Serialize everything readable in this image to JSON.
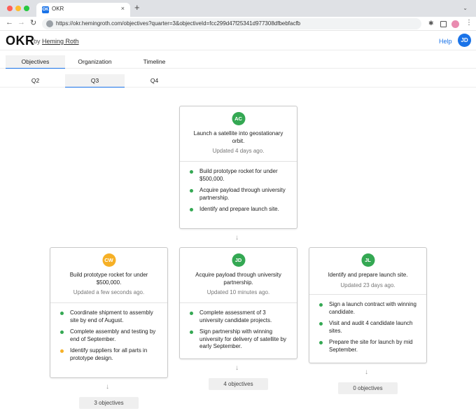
{
  "browser": {
    "tab_icon": "OK",
    "tab_title": "OKR",
    "tab_close": "×",
    "new_tab": "+",
    "url": "https://okr.hemingroth.com/objectives?quarter=3&objectiveId=fcc299d47f25341d977308dfbebfacfb"
  },
  "header": {
    "brand": "OKR",
    "by": "by",
    "author": "Heming Roth",
    "help": "Help",
    "user_initials": "JD"
  },
  "main_tabs": [
    {
      "label": "Objectives",
      "active": true
    },
    {
      "label": "Organization",
      "active": false
    },
    {
      "label": "Timeline",
      "active": false
    }
  ],
  "quarter_tabs": [
    {
      "label": "Q2",
      "active": false
    },
    {
      "label": "Q3",
      "active": true
    },
    {
      "label": "Q4",
      "active": false
    }
  ],
  "colors": {
    "green": "#34a853",
    "orange": "#f6b026",
    "blue": "#1a73e8"
  },
  "root": {
    "initials": "AC",
    "title": "Launch a satellite into geostationary orbit.",
    "updated": "Updated 4 days ago.",
    "key_results": [
      {
        "text": "Build prototype rocket for under $500,000.",
        "status": "green"
      },
      {
        "text": "Acquire payload through university partnership.",
        "status": "green"
      },
      {
        "text": "Identify and prepare launch site.",
        "status": "green"
      }
    ]
  },
  "children": [
    {
      "initials": "CW",
      "avatar_color": "orange",
      "title": "Build prototype rocket for under $500,000.",
      "updated": "Updated a few seconds ago.",
      "key_results": [
        {
          "text": "Coordinate shipment to assembly site by end of August.",
          "status": "green"
        },
        {
          "text": "Complete assembly and testing by end of September.",
          "status": "green"
        },
        {
          "text": "Identify suppliers for all parts in prototype design.",
          "status": "orange"
        }
      ],
      "count": "3 objectives"
    },
    {
      "initials": "JD",
      "avatar_color": "green",
      "title": "Acquire payload through university partnership.",
      "updated": "Updated 10 minutes ago.",
      "key_results": [
        {
          "text": "Complete assessment of 3 university candidate projects.",
          "status": "green"
        },
        {
          "text": "Sign partnership with winning university for delivery of satellite by early September.",
          "status": "green"
        }
      ],
      "count": "4 objectives"
    },
    {
      "initials": "JL",
      "avatar_color": "green",
      "title": "Identify and prepare launch site.",
      "updated": "Updated 23 days ago.",
      "key_results": [
        {
          "text": "Sign a launch contract with winning candidate.",
          "status": "green"
        },
        {
          "text": "Visit and audit 4 candidate launch sites.",
          "status": "green"
        },
        {
          "text": "Prepare the site for launch by mid September.",
          "status": "green"
        }
      ],
      "count": "0 objectives"
    }
  ]
}
